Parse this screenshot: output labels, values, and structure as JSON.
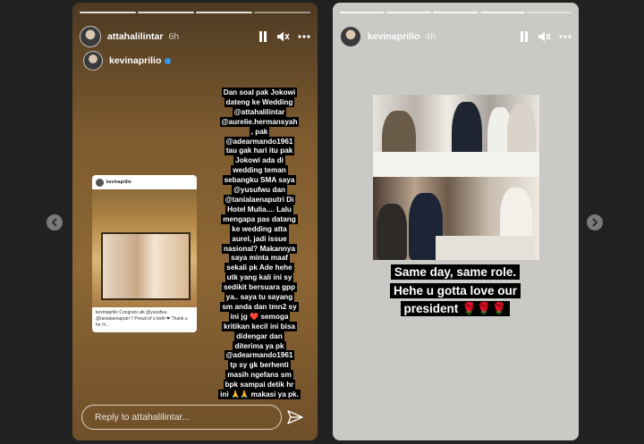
{
  "left_story": {
    "username": "attahalilintar",
    "time": "6h",
    "repost_username": "kevinaprilio",
    "card_username": "kevinaprilio",
    "card_caption": "kevinaprilio Congrats utk @yusufwu @tanialaenaputri !! Proud of u both ❤ Thank u for H...",
    "caption_lines": [
      "Dan soal pak Jokowi",
      "dateng ke Wedding",
      "@attahalilintar",
      "@aurelie.hermansyah",
      ", pak",
      "@adearmando1961",
      "tau gak hari itu pak",
      "Jokowi ada di",
      "wedding teman",
      "sebangku SMA saya",
      "@yusufwu dan",
      "@tanialaenaputri Di",
      "Hotel Mulia.... Lalu",
      "mengapa pas datang",
      "ke wedding atta",
      "aurel, jadi issue",
      "nasional? Makannya",
      "saya minta maaf",
      "sekali pk Ade hehe",
      "utk yang kali ini sy",
      "sedikit bersuara gpp",
      "ya.. saya tu sayang",
      "sm anda dan tmn2 sy",
      "ini jg ❤️ semoga",
      "kritikan kecil ini bisa",
      "didengar dan",
      "diterima ya pk",
      "@adearmando1961",
      "tp sy gk berhenti",
      "masih ngefans sm",
      "bpk sampai detik hr",
      "ini 🙏🙏 makasi ya pk."
    ],
    "reply_placeholder": "Reply to attahalilintar..."
  },
  "right_story": {
    "username": "kevinaprilio",
    "time": "4h",
    "overlay_lines": [
      "Same day, same role.",
      "Hehe u gotta love our",
      "president 🌹🌹🌹"
    ]
  },
  "icons": {
    "pause": "pause-icon",
    "mute": "mute-icon",
    "more": "more-icon",
    "send": "send-icon",
    "prev": "chevron-left-icon",
    "next": "chevron-right-icon"
  }
}
